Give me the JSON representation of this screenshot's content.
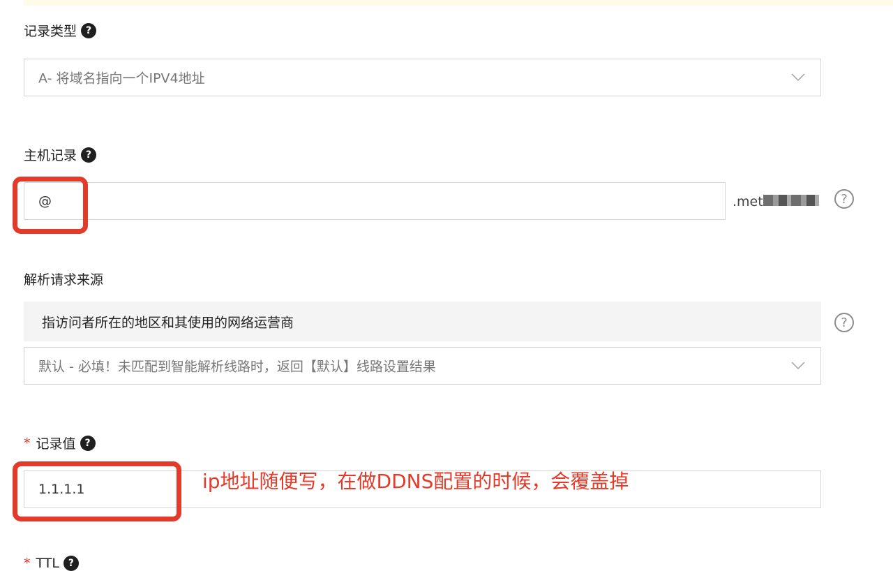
{
  "record_type": {
    "label": "记录类型",
    "help": "?",
    "value": "A- 将域名指向一个IPV4地址"
  },
  "host_record": {
    "label": "主机记录",
    "help": "?",
    "value": "@",
    "domain_suffix": ".met",
    "side_help": "?"
  },
  "resolve_source": {
    "label": "解析请求来源",
    "hint": "指访问者所在的地区和其使用的网络运营商",
    "side_help": "?",
    "value": "默认 - 必填！未匹配到智能解析线路时，返回【默认】线路设置结果"
  },
  "record_value": {
    "required_mark": "*",
    "label": "记录值",
    "help": "?",
    "value": "1.1.1.1"
  },
  "ttl": {
    "required_mark": "*",
    "label": "TTL",
    "help": "?"
  },
  "annotation": {
    "text": "ip地址随便写，在做DDNS配置的时候，会覆盖掉",
    "color": "#e33a2a"
  },
  "icons": {
    "select_arrow": "chevron-down-icon",
    "help": "question-circle-icon"
  }
}
